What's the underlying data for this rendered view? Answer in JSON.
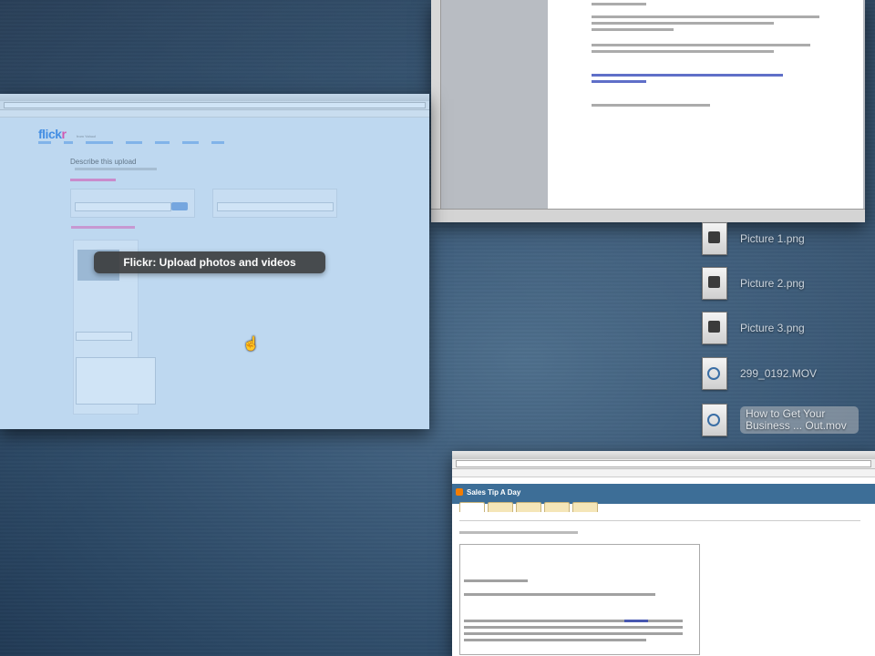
{
  "flickr_window": {
    "tooltip": "Flickr: Upload photos and videos",
    "logo_fl": "flick",
    "logo_kr": "r",
    "logo_yahoo": "from Yahoo!",
    "heading": "Describe this upload"
  },
  "desktop_icons": [
    {
      "label": "Picture 1.png",
      "kind": "png"
    },
    {
      "label": "Picture 2.png",
      "kind": "png"
    },
    {
      "label": "Picture 3.png",
      "kind": "png"
    },
    {
      "label": "299_0192.MOV",
      "kind": "mov"
    },
    {
      "label": "How to Get Your Business ... Out.mov",
      "kind": "mov",
      "selected": true
    }
  ],
  "blogger_window": {
    "blog_title": "Sales Tip A Day"
  },
  "colors": {
    "flickr_blue": "#0063dc",
    "flickr_pink": "#ff0084",
    "blogger_orange": "#f57d00",
    "blogger_header": "#3d6e97"
  }
}
